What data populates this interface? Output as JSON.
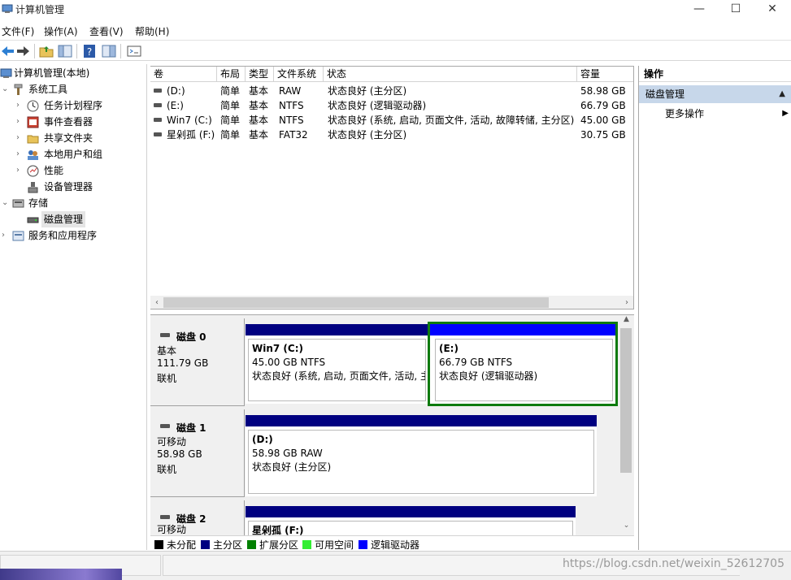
{
  "window": {
    "title": "计算机管理",
    "minimize": "—",
    "maximize": "☐",
    "close": "✕"
  },
  "menu": [
    "文件(F)",
    "操作(A)",
    "查看(V)",
    "帮助(H)"
  ],
  "tree": {
    "root": "计算机管理(本地)",
    "system_tools": "系统工具",
    "task_scheduler": "任务计划程序",
    "event_viewer": "事件查看器",
    "shared_folders": "共享文件夹",
    "local_users": "本地用户和组",
    "performance": "性能",
    "device_manager": "设备管理器",
    "storage": "存储",
    "disk_management": "磁盘管理",
    "services": "服务和应用程序"
  },
  "volumes": {
    "headers": [
      "卷",
      "布局",
      "类型",
      "文件系统",
      "状态",
      "容量"
    ],
    "rows": [
      [
        "(D:)",
        "简单",
        "基本",
        "RAW",
        "状态良好 (主分区)",
        "58.98 GB"
      ],
      [
        "(E:)",
        "简单",
        "基本",
        "NTFS",
        "状态良好 (逻辑驱动器)",
        "66.79 GB"
      ],
      [
        "Win7 (C:)",
        "简单",
        "基本",
        "NTFS",
        "状态良好 (系统, 启动, 页面文件, 活动, 故障转储, 主分区)",
        "45.00 GB"
      ],
      [
        "星剁孤 (F:)",
        "简单",
        "基本",
        "FAT32",
        "状态良好 (主分区)",
        "30.75 GB"
      ]
    ]
  },
  "disks": [
    {
      "name": "磁盘 0",
      "type": "基本",
      "size": "111.79 GB",
      "state": "联机",
      "partitions": [
        {
          "name": "Win7  (C:)",
          "size": "45.00 GB NTFS",
          "status": "状态良好 (系统, 启动, 页面文件, 活动, 主"
        },
        {
          "name": "(E:)",
          "size": "66.79 GB NTFS",
          "status": "状态良好 (逻辑驱动器)"
        }
      ]
    },
    {
      "name": "磁盘 1",
      "type": "可移动",
      "size": "58.98 GB",
      "state": "联机",
      "partitions": [
        {
          "name": "(D:)",
          "size": "58.98 GB RAW",
          "status": "状态良好 (主分区)"
        }
      ]
    },
    {
      "name": "磁盘 2",
      "type": "可移动",
      "partitions": [
        {
          "name": "星剁孤  (F:)"
        }
      ]
    }
  ],
  "legend": [
    {
      "label": "未分配",
      "color": "#000000"
    },
    {
      "label": "主分区",
      "color": "#000080"
    },
    {
      "label": "扩展分区",
      "color": "#008000"
    },
    {
      "label": "可用空间",
      "color": "#33ee33"
    },
    {
      "label": "逻辑驱动器",
      "color": "#0000ff"
    }
  ],
  "actions": {
    "header": "操作",
    "section": "磁盘管理",
    "more": "更多操作"
  },
  "colors": {
    "primary_partition": "#000080",
    "logical_drive": "#0000ff",
    "selection": "#0e7a0e",
    "action_section_bg": "#c7d7ea"
  },
  "watermark": "https://blog.csdn.net/weixin_52612705"
}
